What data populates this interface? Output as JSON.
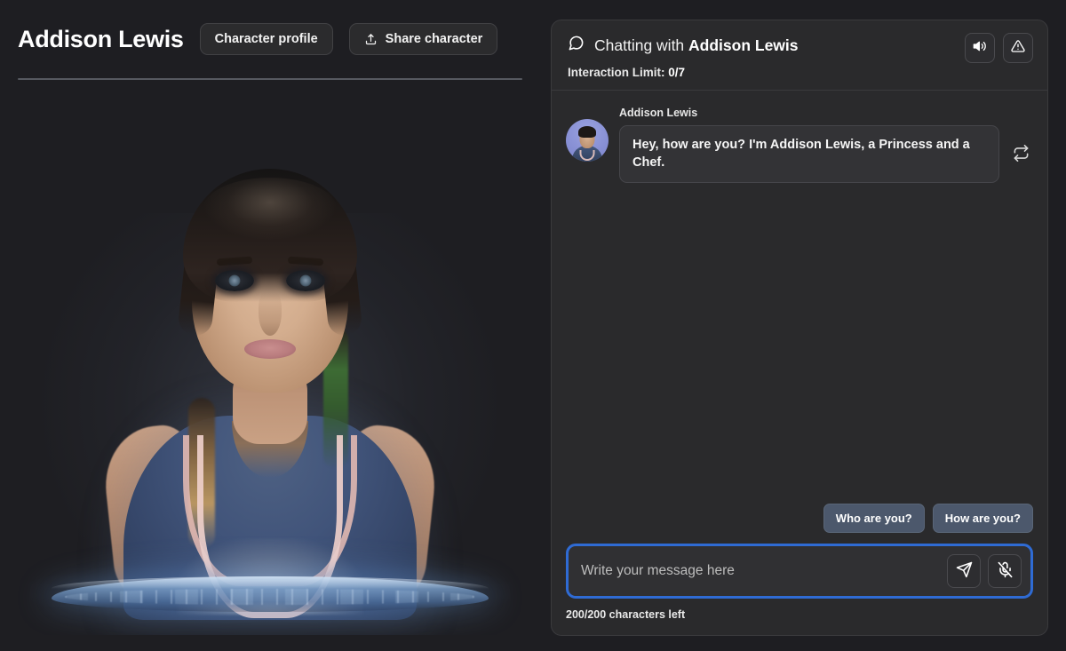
{
  "character": {
    "name": "Addison Lewis",
    "profile_button": "Character profile",
    "share_button": "Share character",
    "share_icon": "share-upload-icon",
    "portrait_alt": "Addison Lewis holographic character portrait"
  },
  "chat": {
    "header": {
      "chat_icon": "speech-bubble-icon",
      "prefix": "Chatting with ",
      "name": "Addison Lewis",
      "speaker_icon": "speaker-volume-icon",
      "warning_icon": "warning-triangle-icon"
    },
    "interaction_limit": {
      "label": "Interaction Limit: ",
      "value": "0/7"
    },
    "messages": [
      {
        "sender": "Addison Lewis",
        "text": "Hey, how are you? I'm Addison Lewis, a Princess and a Chef.",
        "avatar": "addison-lewis-avatar",
        "regenerate_icon": "repeat-arrows-icon"
      }
    ],
    "suggestions": [
      {
        "label": "Who are you?"
      },
      {
        "label": "How are you?"
      }
    ],
    "composer": {
      "placeholder": "Write your message here",
      "value": "",
      "send_icon": "send-paper-plane-icon",
      "mic_icon": "microphone-muted-icon",
      "char_count": "200/200 characters left"
    }
  },
  "colors": {
    "page_background": "#1e1e22",
    "panel_background": "#2a2a2c",
    "bubble_background": "#333336",
    "chip_background": "#4c586c",
    "focus_ring": "#2f6bd4",
    "avatar_background": "#878fd4"
  }
}
